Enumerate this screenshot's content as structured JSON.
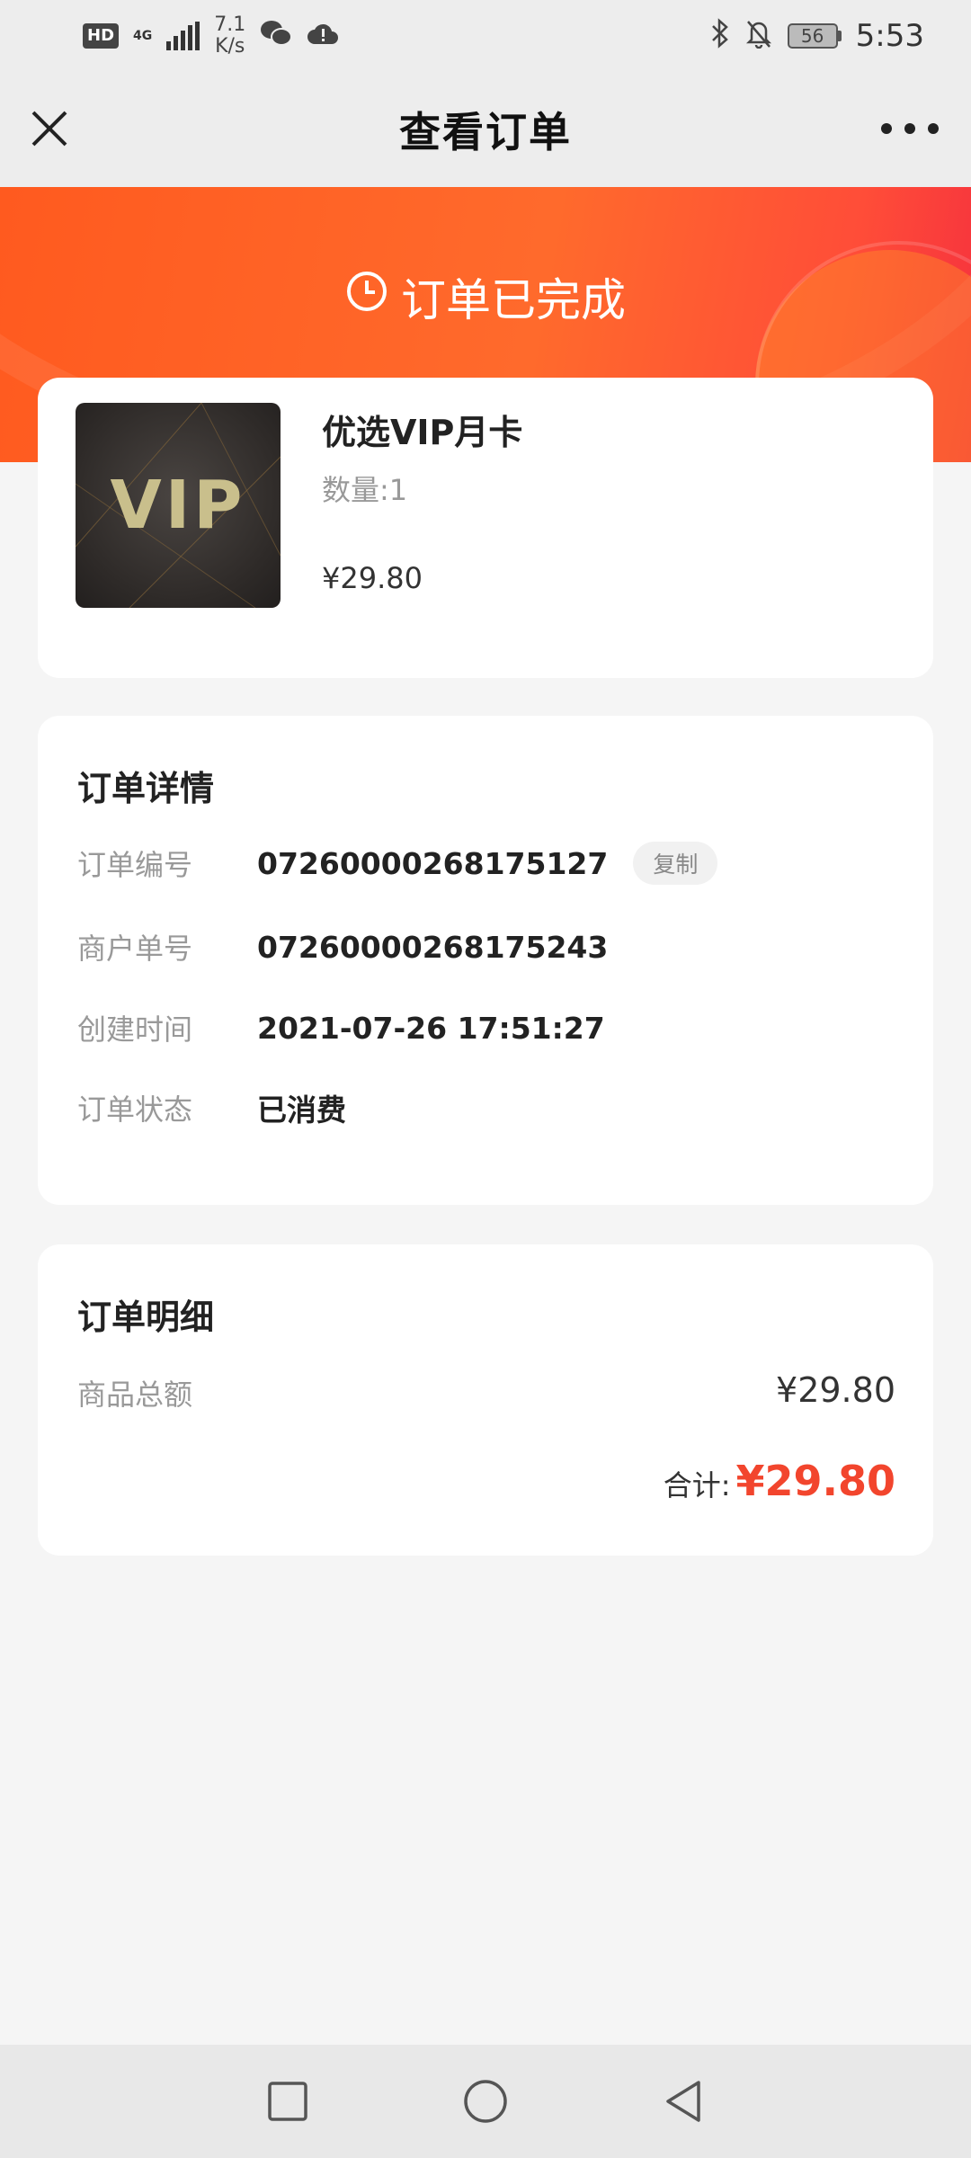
{
  "status_bar": {
    "hd": "HD",
    "network": "4G",
    "speed_value": "7.1",
    "speed_unit": "K/s",
    "battery": "56",
    "time": "5:53",
    "icons": [
      "wechat-icon",
      "cloud-alert-icon",
      "bluetooth-icon",
      "mute-bell-icon"
    ]
  },
  "header": {
    "title": "查看订单",
    "close_icon": "close-icon",
    "more_icon": "more-dots-icon"
  },
  "banner": {
    "status": "订单已完成",
    "icon": "clock-icon",
    "colors": {
      "start": "#ff5a1f",
      "end": "#f5303e"
    }
  },
  "product": {
    "thumb_text": "VIP",
    "name": "优选VIP月卡",
    "quantity": "数量:1",
    "price": "¥29.80"
  },
  "order_detail": {
    "title": "订单详情",
    "rows": [
      {
        "label": "订单编号",
        "value": "07260000268175127"
      },
      {
        "label": "商户单号",
        "value": "07260000268175243"
      },
      {
        "label": "创建时间",
        "value": "2021-07-26 17:51:27"
      },
      {
        "label": "订单状态",
        "value": "已消费"
      }
    ],
    "copy_label": "复制"
  },
  "order_summary": {
    "title": "订单明细",
    "subtotal_label": "商品总额",
    "subtotal_value": "¥29.80",
    "total_label": "合计:",
    "total_value": "¥29.80",
    "accent_color": "#f2452d"
  },
  "nav_bar": {
    "items": [
      "recent-apps-square-icon",
      "home-circle-icon",
      "back-triangle-icon"
    ]
  }
}
